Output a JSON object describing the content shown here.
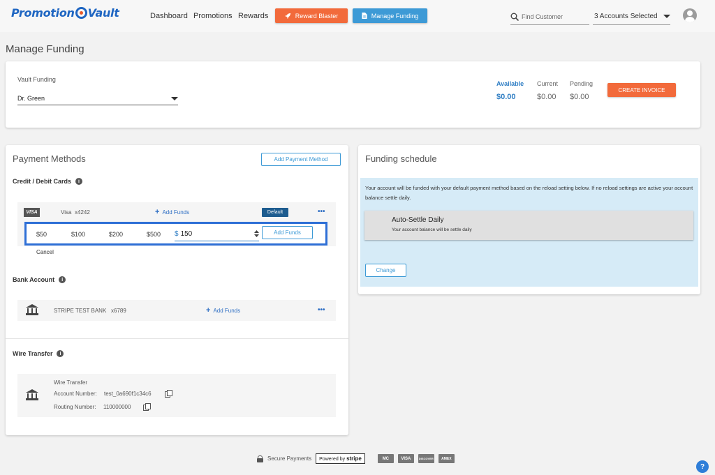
{
  "nav": {
    "logo_left": "Promotion",
    "logo_right": "Vault",
    "links": [
      "Dashboard",
      "Promotions",
      "Rewards"
    ],
    "reward_blaster": "Reward Blaster",
    "manage_funding": "Manage Funding",
    "search_placeholder": "Find Customer",
    "accounts_selected": "3 Accounts Selected"
  },
  "page_title": "Manage Funding",
  "vault": {
    "label": "Vault Funding",
    "selected": "Dr. Green",
    "available_label": "Available",
    "available_value": "$0.00",
    "current_label": "Current",
    "current_value": "$0.00",
    "pending_label": "Pending",
    "pending_value": "$0.00",
    "create_invoice": "CREATE INVOICE"
  },
  "payment": {
    "title": "Payment Methods",
    "add_method": "Add Payment Method",
    "cards_heading": "Credit / Debit Cards",
    "card": {
      "brand": "VISA",
      "name": "Visa",
      "last4": "x4242",
      "add_funds": "Add Funds",
      "default_badge": "Default",
      "more": "•••"
    },
    "amounts": [
      "$50",
      "$100",
      "$200",
      "$500"
    ],
    "currency_symbol": "$",
    "amount_value": "150",
    "add_funds_button": "Add Funds",
    "cancel": "Cancel",
    "bank_heading": "Bank Account",
    "bank": {
      "name": "STRIPE TEST BANK",
      "last4": "x6789",
      "add_funds": "Add Funds",
      "more": "•••"
    },
    "wire_heading": "Wire Transfer",
    "wire": {
      "title": "Wire Transfer",
      "account_label": "Account Number:",
      "account_value": "test_0a690f1c34c6",
      "routing_label": "Routing Number:",
      "routing_value": "110000000"
    }
  },
  "schedule": {
    "title": "Funding schedule",
    "notice": "Your account will be funded with your default payment method based on the reload setting below. If no reload settings are active your account balance settle daily.",
    "option_title": "Auto-Settle Daily",
    "option_desc": "Your account balance will be settle daily",
    "change": "Change"
  },
  "footer": {
    "secure": "Secure Payments",
    "powered_by": "Powered by",
    "stripe": "stripe",
    "cards": [
      "MC",
      "VISA",
      "DISCOVER",
      "AMEX"
    ]
  },
  "help": "?",
  "colors": {
    "accent_orange": "#f26a3b",
    "accent_blue": "#3d9ad6",
    "link_blue": "#2f6fc4"
  }
}
